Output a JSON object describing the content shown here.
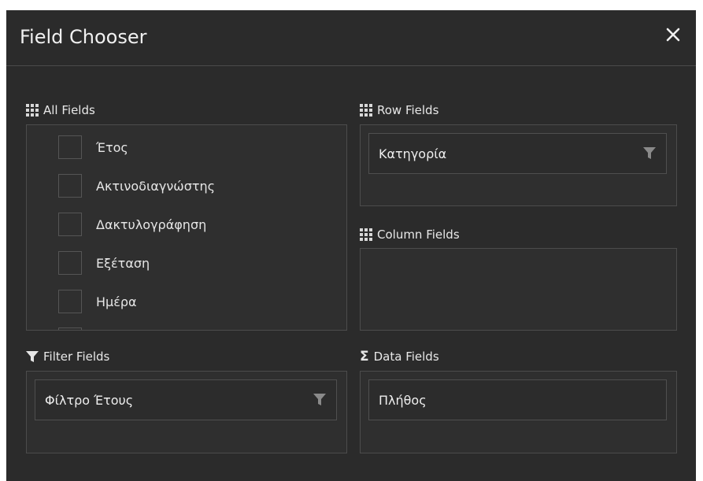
{
  "dialog": {
    "title": "Field Chooser",
    "close_icon": "close-icon"
  },
  "all_fields": {
    "label": "All Fields",
    "icon": "grid-icon",
    "items": [
      {
        "label": "Έτος",
        "checked": false
      },
      {
        "label": "Ακτινοδιαγνώστης",
        "checked": false
      },
      {
        "label": "Δακτυλογράφηση",
        "checked": false
      },
      {
        "label": "Εξέταση",
        "checked": false
      },
      {
        "label": "Ημέρα",
        "checked": false
      }
    ]
  },
  "row_fields": {
    "label": "Row Fields",
    "icon": "grid-icon",
    "items": [
      {
        "label": "Κατηγορία",
        "icon": "filter-icon"
      }
    ]
  },
  "column_fields": {
    "label": "Column Fields",
    "icon": "grid-icon",
    "items": []
  },
  "filter_fields": {
    "label": "Filter Fields",
    "icon": "filter-icon",
    "items": [
      {
        "label": "Φίλτρο Έτους",
        "icon": "filter-icon"
      }
    ]
  },
  "data_fields": {
    "label": "Data Fields",
    "icon": "sigma-icon",
    "items": [
      {
        "label": "Πλήθος"
      }
    ]
  },
  "colors": {
    "background": "#2b2b2b",
    "panel": "#2f2f2f",
    "border": "#4c4c4c",
    "text": "#e6e6e6",
    "icon": "#b0b0b0"
  }
}
